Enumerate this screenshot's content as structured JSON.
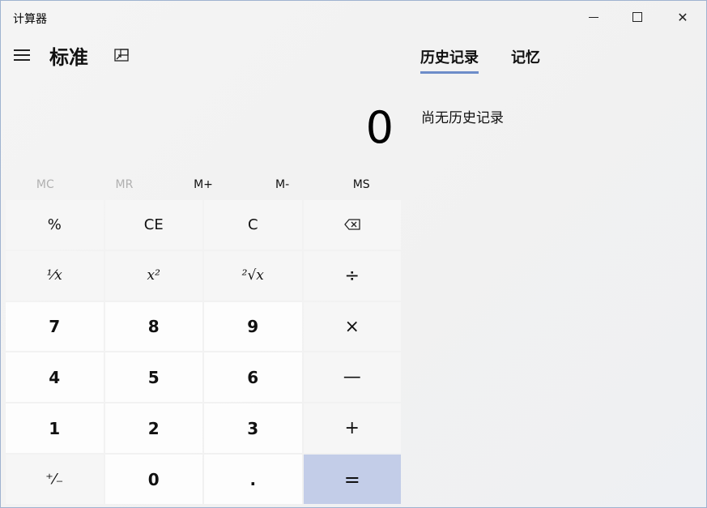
{
  "window": {
    "title": "计算器",
    "minimize_glyph": "—",
    "close_glyph": "✕"
  },
  "header": {
    "mode_title": "标准"
  },
  "display": {
    "value": "0"
  },
  "memory": {
    "buttons": [
      {
        "label": "MC",
        "enabled": false
      },
      {
        "label": "MR",
        "enabled": false
      },
      {
        "label": "M+",
        "enabled": true
      },
      {
        "label": "M-",
        "enabled": true
      },
      {
        "label": "MS",
        "enabled": true
      }
    ]
  },
  "keypad": {
    "percent": "%",
    "ce": "CE",
    "c": "C",
    "backspace": "⌫",
    "reciprocal": "¹⁄x",
    "square": "x²",
    "sqrt": "²√x",
    "divide": "÷",
    "k7": "7",
    "k8": "8",
    "k9": "9",
    "multiply": "×",
    "k4": "4",
    "k5": "5",
    "k6": "6",
    "minus": "—",
    "k1": "1",
    "k2": "2",
    "k3": "3",
    "plus": "+",
    "negate": "⁺⁄₋",
    "k0": "0",
    "decimal": ".",
    "equals": "="
  },
  "panel": {
    "tabs": [
      {
        "label": "历史记录",
        "active": true
      },
      {
        "label": "记忆",
        "active": false
      }
    ],
    "empty_message": "尚无历史记录"
  },
  "colors": {
    "equals_bg": "#c3cde8",
    "tab_underline": "#6d8cc9"
  }
}
